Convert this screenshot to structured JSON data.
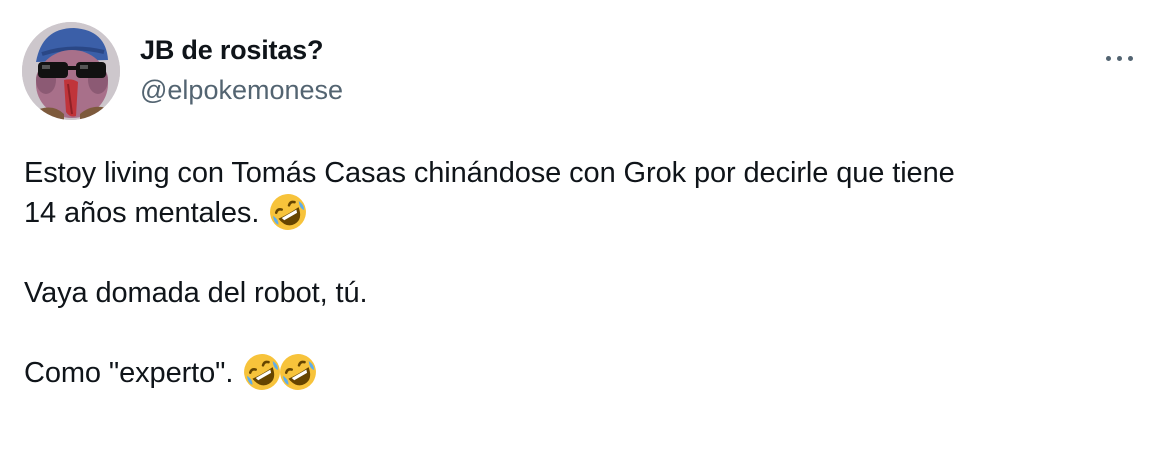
{
  "author": {
    "display_name": "JB de rositas?",
    "handle": "@elpokemonese",
    "avatar_icon": "avatar-cartoon-sunglasses"
  },
  "more_icon": "more-dots-icon",
  "tweet": {
    "line1": "Estoy living con Tomás Casas chinándose con Grok por decirle que tiene",
    "line2": "14 años mentales.",
    "line3": "Vaya domada del robot, tú.",
    "line4": "Como \"experto\".",
    "emoji_icon": "rolling-on-the-floor-laughing-emoji"
  },
  "colors": {
    "text": "#0f1419",
    "secondary": "#536471",
    "emoji_face": "#f7c33b"
  }
}
